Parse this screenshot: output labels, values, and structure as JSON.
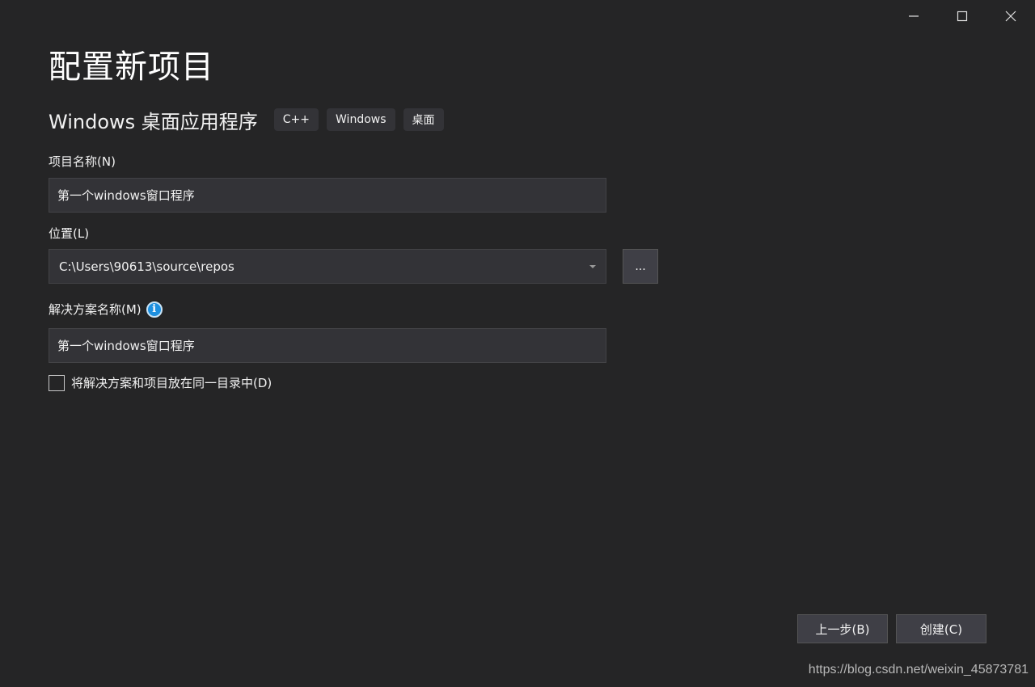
{
  "window": {
    "controls": {
      "minimize_icon": "minimize-icon",
      "maximize_icon": "maximize-icon",
      "close_icon": "close-icon"
    }
  },
  "page_title": "配置新项目",
  "template": {
    "name": "Windows 桌面应用程序",
    "tags": [
      "C++",
      "Windows",
      "桌面"
    ]
  },
  "project_name": {
    "label": "项目名称(N)",
    "value": "第一个windows窗口程序"
  },
  "location": {
    "label": "位置(L)",
    "value": "C:\\Users\\90613\\source\\repos",
    "browse_label": "..."
  },
  "solution_name": {
    "label": "解决方案名称(M)",
    "info_icon": "i",
    "value": "第一个windows窗口程序"
  },
  "same_directory": {
    "label": "将解决方案和项目放在同一目录中(D)",
    "checked": false
  },
  "footer": {
    "back_label": "上一步(B)",
    "create_label": "创建(C)"
  },
  "watermark": "https://blog.csdn.net/weixin_45873781",
  "colors": {
    "background": "#252526",
    "input_background": "#333337",
    "button_background": "#3f3f46",
    "info_icon": "#1e90e0",
    "text": "#f1f1f1"
  }
}
